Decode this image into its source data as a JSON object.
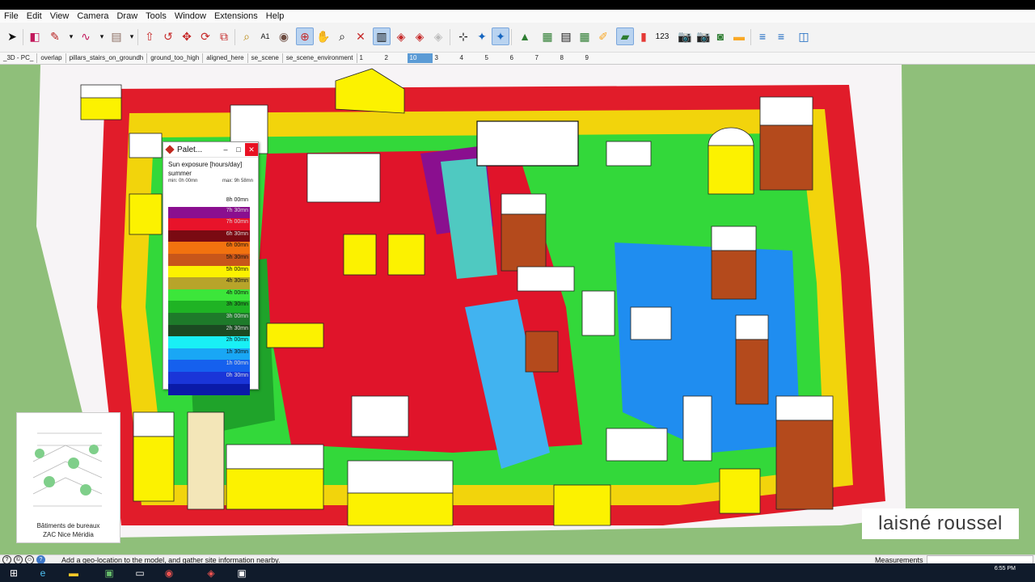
{
  "menu": [
    "File",
    "Edit",
    "View",
    "Camera",
    "Draw",
    "Tools",
    "Window",
    "Extensions",
    "Help"
  ],
  "scenes": {
    "tabs": [
      "_3D - PC_",
      "overlap",
      "pillars_stairs_on_groundh",
      "ground_too_high",
      "aligned_here",
      "se_scene",
      "se_scene_environment"
    ],
    "numbers": [
      "1",
      "2",
      "10",
      "3",
      "4",
      "5",
      "6",
      "7",
      "8",
      "9"
    ],
    "active_number": "10"
  },
  "palette": {
    "title": "Palet...",
    "heading": "Sun exposure [hours/day]",
    "season": "summer",
    "min_label": "min: 0h 00mn",
    "max_label": "max: 9h 58mn",
    "top_label": "8h 00mn",
    "scale": [
      {
        "color": "#8a0f8f",
        "label": "7h 30mn"
      },
      {
        "color": "#e8132a",
        "label": "7h 00mn"
      },
      {
        "color": "#7a0a12",
        "label": "6h 30mn"
      },
      {
        "color": "#f2720f",
        "label": "6h 00mn"
      },
      {
        "color": "#c8561a",
        "label": "5h 30mn"
      },
      {
        "color": "#fcf200",
        "label": "5h 00mn"
      },
      {
        "color": "#b8a42a",
        "label": "4h 30mn"
      },
      {
        "color": "#3ce63a",
        "label": "4h 00mn"
      },
      {
        "color": "#1fb324",
        "label": "3h 30mn"
      },
      {
        "color": "#1e7a2a",
        "label": "3h 00mn"
      },
      {
        "color": "#1b4a22",
        "label": "2h 30mn"
      },
      {
        "color": "#19f0f5",
        "label": "2h 00mn"
      },
      {
        "color": "#19a7f5",
        "label": "1h 30mn"
      },
      {
        "color": "#1560ee",
        "label": "1h 00mn"
      },
      {
        "color": "#1a35d8",
        "label": "0h 30mn"
      },
      {
        "color": "#0a1aa8",
        "label": ""
      }
    ]
  },
  "brand": {
    "caption_line1": "Bâtiments de bureaux",
    "caption_line2": "ZAC Nice Méridia"
  },
  "logo": {
    "text": "laisné roussel"
  },
  "status": {
    "message": "Add a geo-location to the model, and gather site information nearby.",
    "measurements_label": "Measurements"
  },
  "taskbar": {
    "time": "6:55 PM"
  }
}
